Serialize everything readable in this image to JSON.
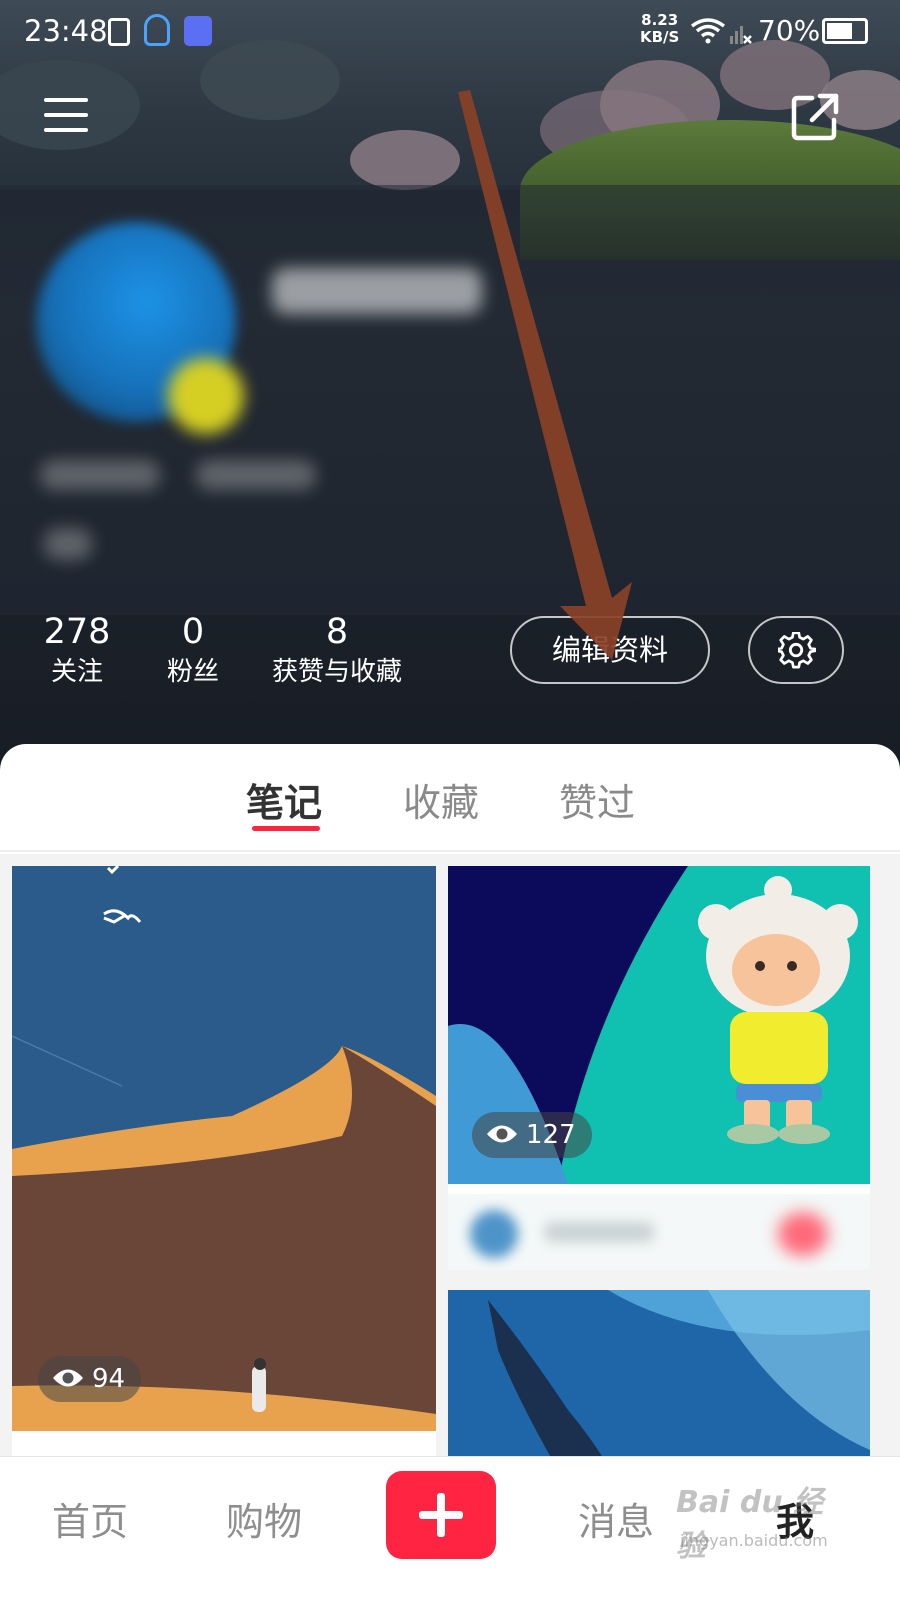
{
  "status_bar": {
    "time": "23:48",
    "net_speed_value": "8.23",
    "net_speed_unit": "KB/S",
    "battery_percent": "70%",
    "battery_level": 0.7
  },
  "profile": {
    "stats": [
      {
        "value": "278",
        "label": "关注"
      },
      {
        "value": "0",
        "label": "粉丝"
      },
      {
        "value": "8",
        "label": "获赞与收藏"
      }
    ],
    "edit_button_label": "编辑资料"
  },
  "tabs": [
    {
      "label": "笔记",
      "active": true
    },
    {
      "label": "收藏",
      "active": false
    },
    {
      "label": "赞过",
      "active": false
    }
  ],
  "notes": [
    {
      "views": "94"
    },
    {
      "views": "127"
    }
  ],
  "bottom_nav": [
    {
      "label": "首页",
      "active": false
    },
    {
      "label": "购物",
      "active": false
    },
    {
      "label": "消息",
      "active": false
    },
    {
      "label": "我",
      "active": true
    }
  ],
  "watermark": {
    "text": "Bai du 经验",
    "sub": "jingyan.baidu.com"
  },
  "colors": {
    "accent": "#ff2442",
    "annotation_arrow": "#8a4127"
  }
}
